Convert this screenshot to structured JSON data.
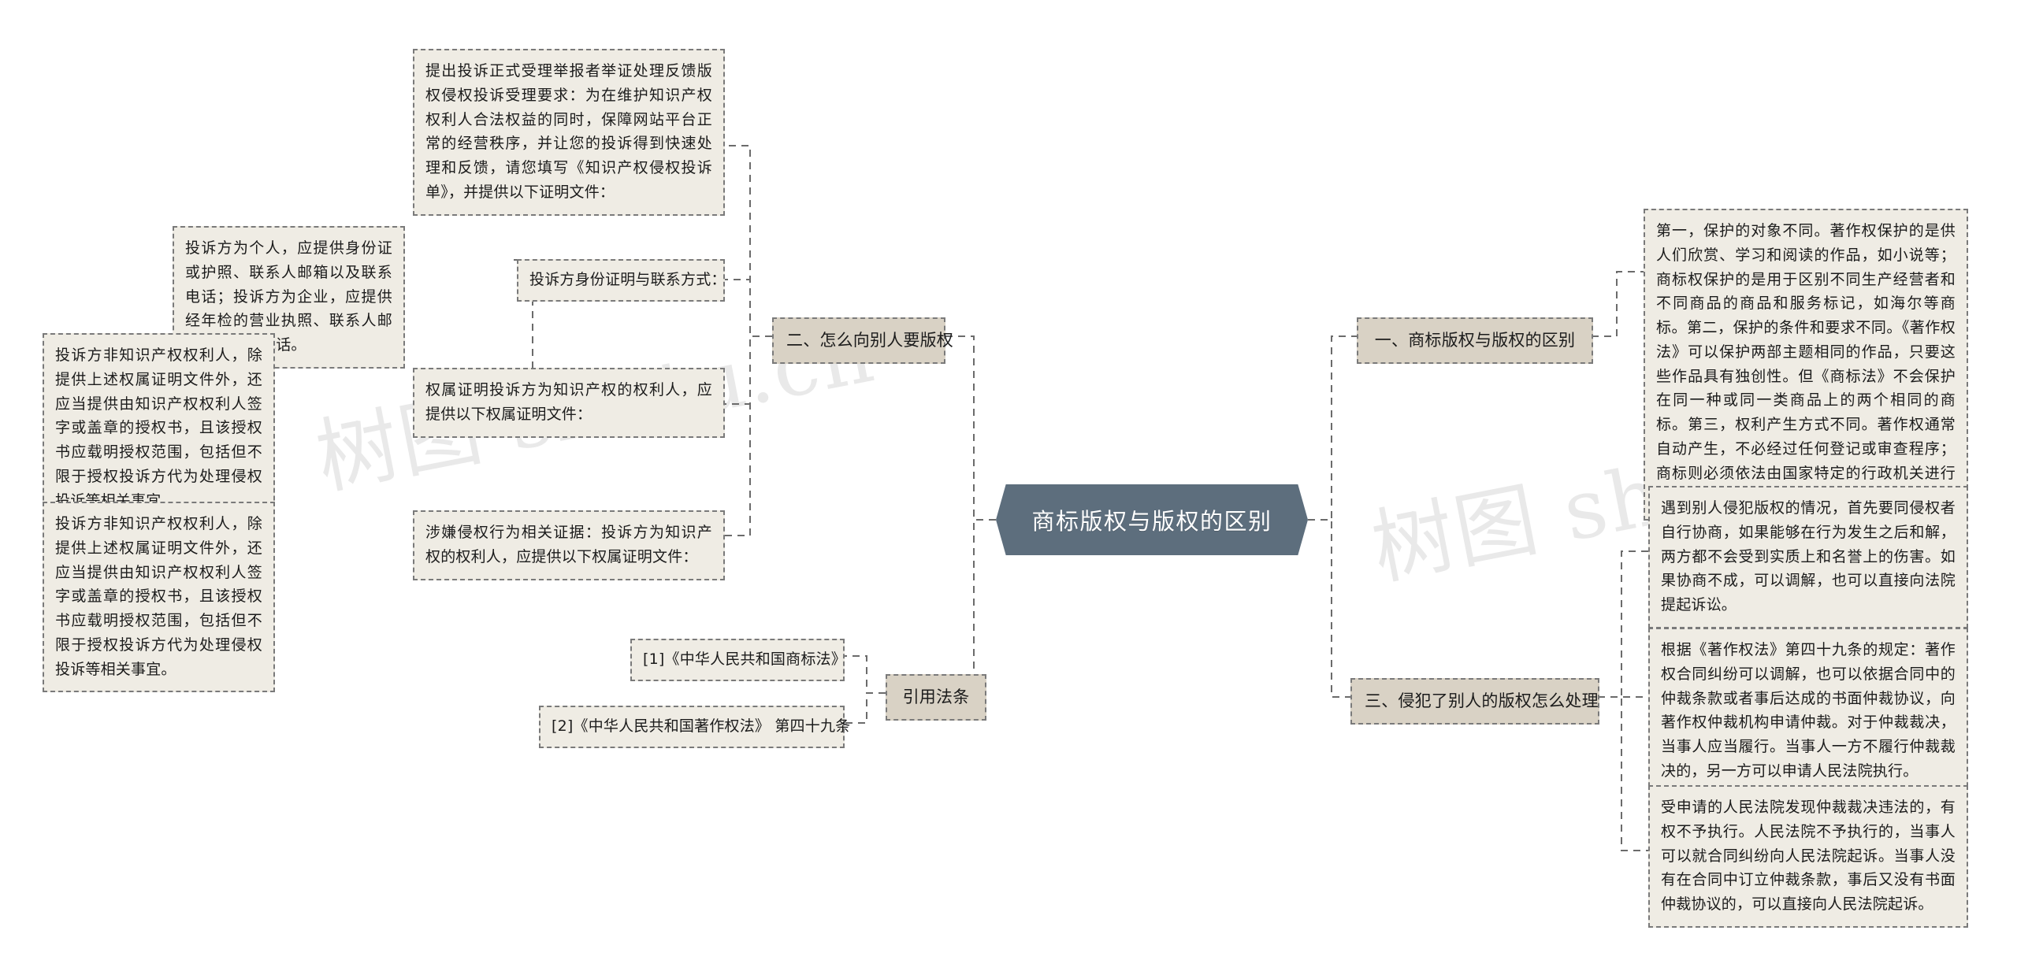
{
  "diagram": {
    "title": "商标版权与版权的区别",
    "type": "mind-map",
    "colors": {
      "root_fill": "#5d6e7d",
      "root_text": "#ffffff",
      "branch_fill": "#d9d2c5",
      "leaf_fill": "#efece4",
      "border": "#7a7a7a",
      "connector": "#6b6b6b",
      "background": "#ffffff"
    }
  },
  "watermark": {
    "left_text": "树图 shutu.cn",
    "right_text": "树图 shutu.cn"
  },
  "root": {
    "label": "商标版权与版权的区别"
  },
  "branches": {
    "branch_one": {
      "label": "一、商标版权与版权的区别",
      "children": [
        {
          "label": "第一，保护的对象不同。著作权保护的是供人们欣赏、学习和阅读的作品，如小说等；商标权保护的是用于区别不同生产经营者和不同商品的商品和服务标记，如海尔等商标。第二，保护的条件和要求不同。《著作权法》可以保护两部主题相同的作品，只要这些作品具有独创性。但《商标法》不会保护在同一种或同一类商品上的两个相同的商标。第三，权利产生方式不同。著作权通常自动产生，不必经过任何登记或审查程序；商标则必须依法由国家特定的行政机关进行审查后授予合法申请人。"
        }
      ]
    },
    "branch_two": {
      "label": "二、怎么向别人要版权",
      "children": [
        {
          "label": "提出投诉正式受理举报者举证处理反馈版权侵权投诉受理要求：为在维护知识产权权利人合法权益的同时，保障网站平台正常的经营秩序，并让您的投诉得到快速处理和反馈，请您填写《知识产权侵权投诉单》，并提供以下证明文件："
        },
        {
          "label": "投诉方身份证明与联系方式：",
          "children": [
            {
              "label": "投诉方为个人，应提供身份证或护照、联系人邮箱以及联系电话；投诉方为企业，应提供经年检的营业执照、联系人邮箱以及联系电话。"
            },
            {
              "label": "投诉方非知识产权权利人，除提供上述权属证明文件外，还应当提供由知识产权权利人签字或盖章的授权书，且该授权书应载明授权范围，包括但不限于授权投诉方代为处理侵权投诉等相关事宜。"
            }
          ]
        },
        {
          "label": "权属证明投诉方为知识产权的权利人，应提供以下权属证明文件："
        },
        {
          "label": "涉嫌侵权行为相关证据：投诉方为知识产权的权利人，应提供以下权属证明文件：",
          "children": [
            {
              "label": "投诉方非知识产权权利人，除提供上述权属证明文件外，还应当提供由知识产权权利人签字或盖章的授权书，且该授权书应载明授权范围，包括但不限于授权投诉方代为处理侵权投诉等相关事宜。"
            }
          ]
        }
      ]
    },
    "branch_three": {
      "label": "三、侵犯了别人的版权怎么处理",
      "children": [
        {
          "label": "遇到别人侵犯版权的情况，首先要同侵权者自行协商，如果能够在行为发生之后和解，两方都不会受到实质上和名誉上的伤害。如果协商不成，可以调解，也可以直接向法院提起诉讼。"
        },
        {
          "label": "根据《著作权法》第四十九条的规定：著作权合同纠纷可以调解，也可以依据合同中的仲裁条款或者事后达成的书面仲裁协议，向著作权仲裁机构申请仲裁。对于仲裁裁决，当事人应当履行。当事人一方不履行仲裁裁决的，另一方可以申请人民法院执行。"
        },
        {
          "label": "受申请的人民法院发现仲裁裁决违法的，有权不予执行。人民法院不予执行的，当事人可以就合同纠纷向人民法院起诉。当事人没有在合同中订立仲裁条款，事后又没有书面仲裁协议的，可以直接向人民法院起诉。"
        }
      ]
    },
    "branch_refs": {
      "label": "引用法条",
      "children": [
        {
          "label": "[1]《中华人民共和国商标法》"
        },
        {
          "label": "[2]《中华人民共和国著作权法》 第四十九条"
        }
      ]
    }
  }
}
